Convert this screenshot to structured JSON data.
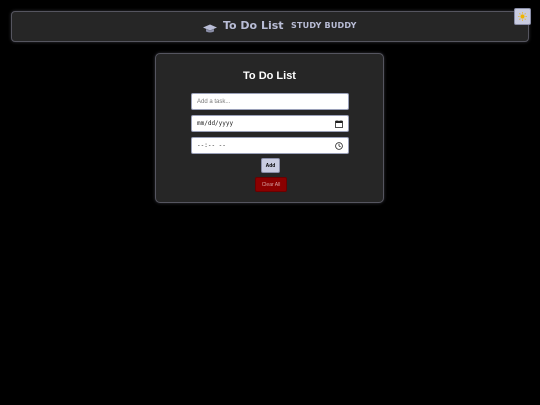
{
  "navbar": {
    "brand_title": "To Do List",
    "brand_icon": "graduation-cap-icon",
    "nav_link": "STUDY BUDDY",
    "theme_toggle_icon": "sun-icon"
  },
  "card": {
    "title": "To Do List",
    "task_input": {
      "placeholder": "Add a task...",
      "value": ""
    },
    "date_input": {
      "display": "mm/dd/yyyy",
      "icon": "calendar-icon"
    },
    "time_input": {
      "display": "--:-- --",
      "icon": "clock-icon"
    },
    "add_label": "Add",
    "clear_label": "Clear All"
  },
  "colors": {
    "background": "#000000",
    "panel": "#262626",
    "accent": "#c9cce0",
    "danger": "#8b0000",
    "text_light": "#b9bdd6"
  }
}
